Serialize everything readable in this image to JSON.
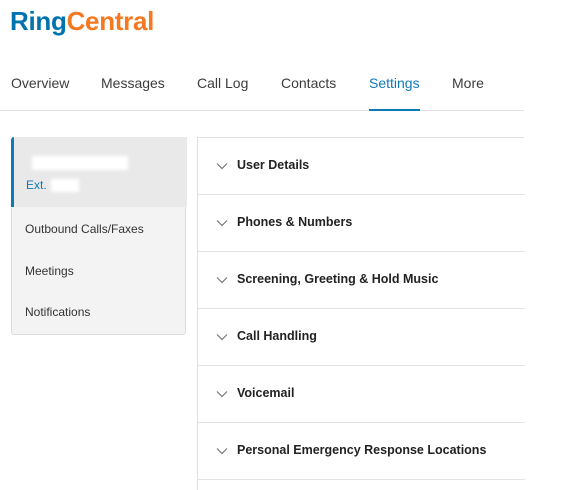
{
  "logo": {
    "part1": "Ring",
    "part2": "Central"
  },
  "nav": {
    "tabs": [
      {
        "label": "Overview"
      },
      {
        "label": "Messages"
      },
      {
        "label": "Call Log"
      },
      {
        "label": "Contacts"
      },
      {
        "label": "Settings",
        "active": true
      },
      {
        "label": "More"
      }
    ]
  },
  "sidebar": {
    "ext_label": "Ext.",
    "items": [
      {
        "label": "Outbound Calls/Faxes"
      },
      {
        "label": "Meetings"
      },
      {
        "label": "Notifications"
      }
    ]
  },
  "sections": [
    {
      "title": "User Details",
      "icon": "chevron-down-icon"
    },
    {
      "title": "Phones & Numbers",
      "icon": "chevron-down-icon"
    },
    {
      "title": "Screening, Greeting & Hold Music",
      "icon": "chevron-down-icon"
    },
    {
      "title": "Call Handling",
      "icon": "chevron-down-icon"
    },
    {
      "title": "Voicemail",
      "icon": "chevron-down-icon"
    },
    {
      "title": "Personal Emergency Response Locations",
      "icon": "chevron-down-icon"
    }
  ],
  "colors": {
    "brand_blue": "#0073ae",
    "brand_orange": "#f47920",
    "accent": "#0f7ab8"
  }
}
